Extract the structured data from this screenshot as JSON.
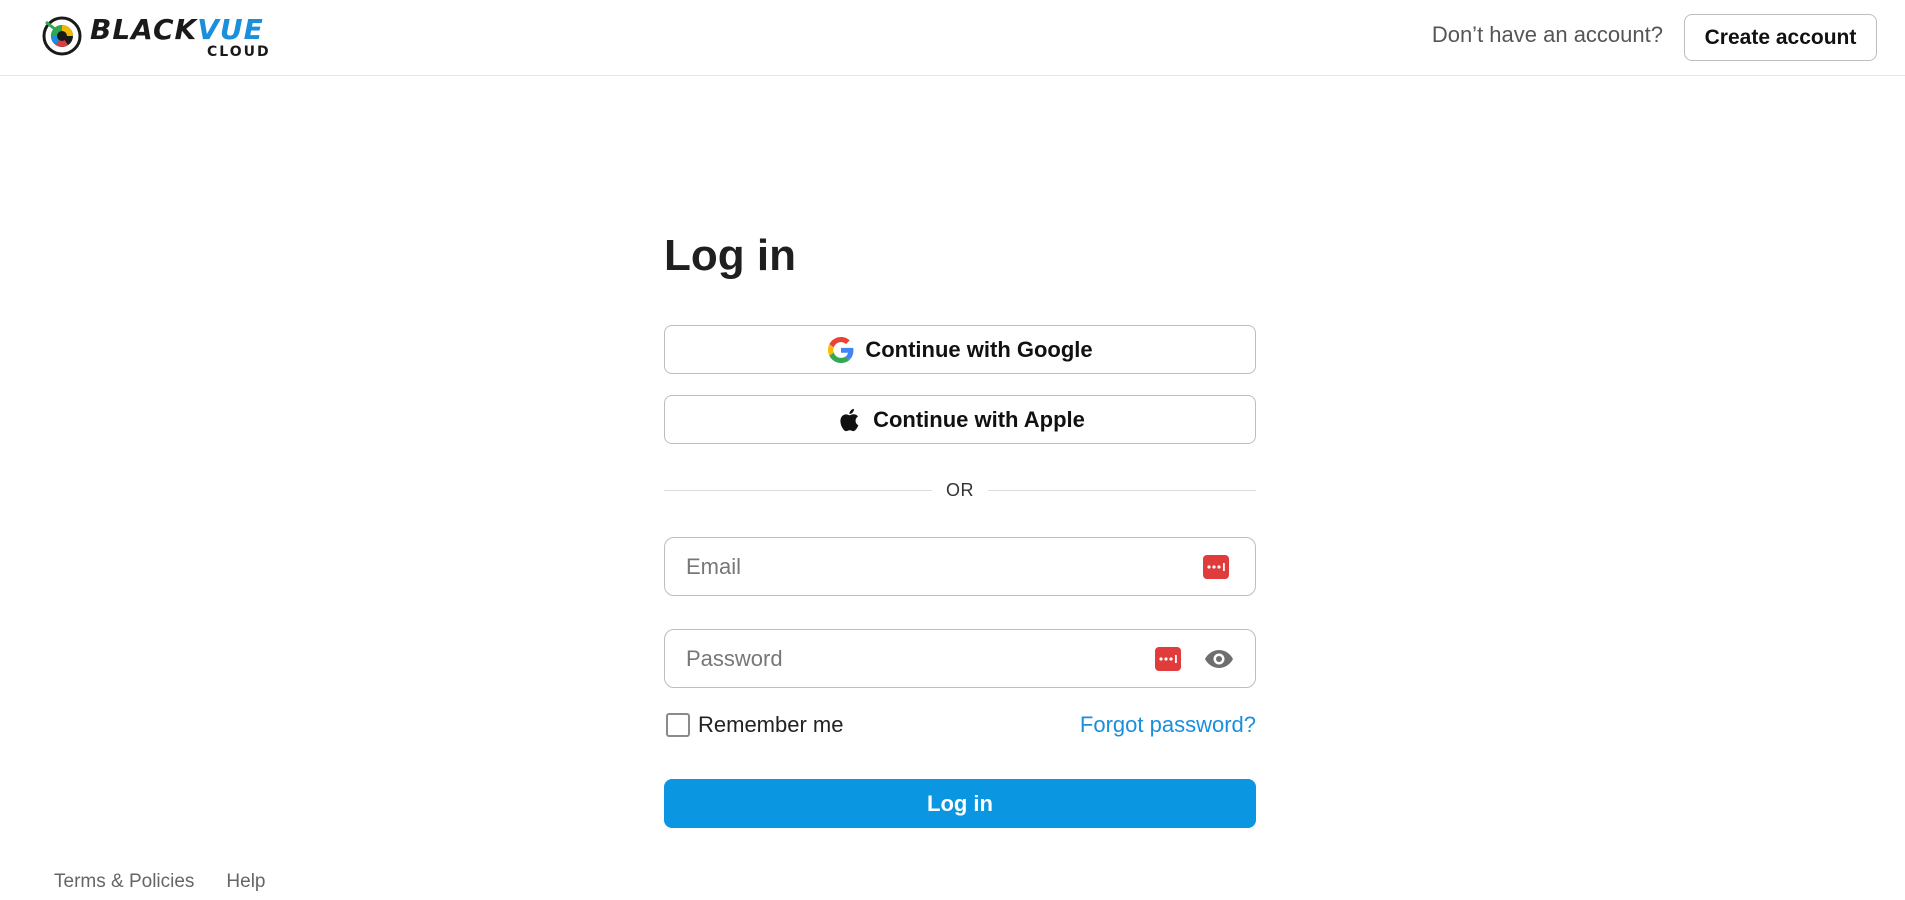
{
  "brand": {
    "word_black": "BLACK",
    "word_vue": "VUE",
    "sub": "CLOUD",
    "accent_color": "#1a8fdc"
  },
  "header": {
    "prompt": "Don’t have an account?",
    "create_account_label": "Create account"
  },
  "form": {
    "title": "Log in",
    "google_label": "Continue with Google",
    "apple_label": "Continue with Apple",
    "divider_text": "OR",
    "email_placeholder": "Email",
    "email_value": "",
    "password_placeholder": "Password",
    "password_value": "",
    "remember_label": "Remember me",
    "remember_checked": false,
    "forgot_label": "Forgot password?",
    "login_label": "Log in",
    "login_color": "#0a96e0"
  },
  "icons": {
    "google": "google-icon",
    "apple": "apple-icon",
    "password_manager": "password-manager-icon",
    "show_password": "eye-icon"
  },
  "footer": {
    "links": [
      "Terms & Policies",
      "Help"
    ]
  }
}
